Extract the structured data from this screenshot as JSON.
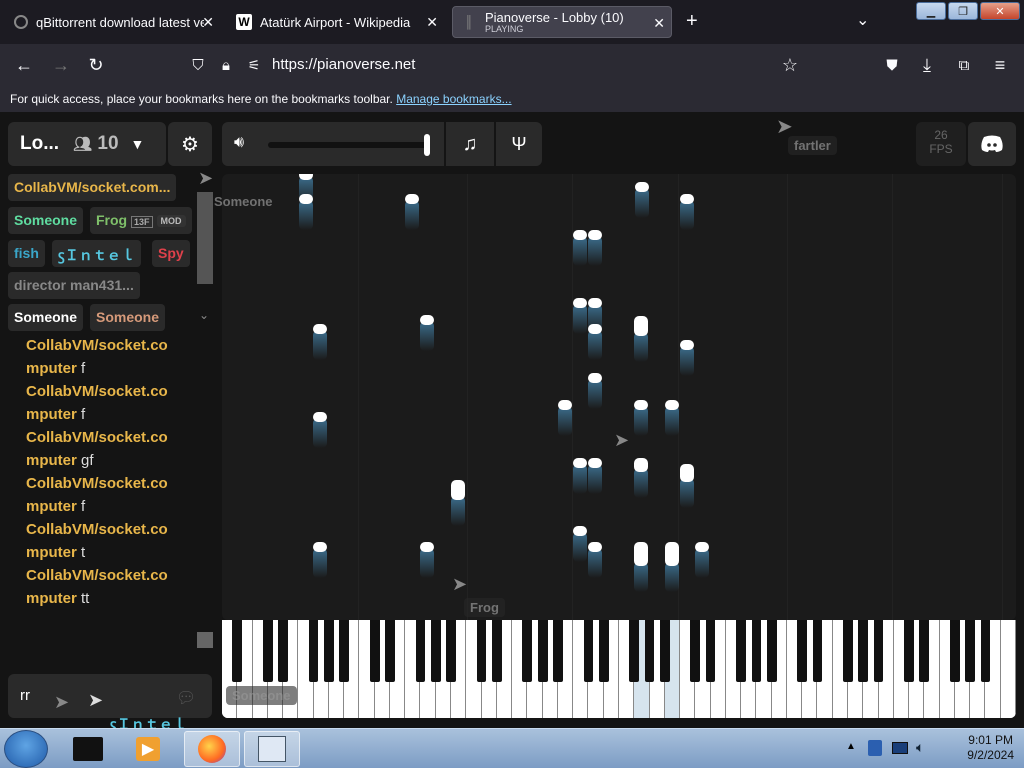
{
  "browser": {
    "tabs": [
      {
        "title": "qBittorrent download latest ver",
        "sub": ""
      },
      {
        "title": "Atatürk Airport - Wikipedia",
        "sub": ""
      },
      {
        "title": "Pianoverse - Lobby (10)",
        "sub": "PLAYING"
      }
    ],
    "url": "https://pianoverse.net",
    "bookmarks_text": "For quick access, place your bookmarks here on the bookmarks toolbar.",
    "bookmarks_link": "Manage bookmarks..."
  },
  "lobby": {
    "name": "Lo...",
    "count": "10",
    "fps_value": "26",
    "fps_label": "FPS"
  },
  "users": [
    {
      "name": "CollabVM/socket.com...",
      "color": "#e8b64a"
    },
    {
      "name": "Someone",
      "color": "#5fdca0"
    },
    {
      "name": "Frog",
      "color": "#7fc06a",
      "badge": "MOD"
    },
    {
      "name": "fish",
      "color": "#3aa6c9"
    },
    {
      "name": "ꚃＩｎｔｅｌ",
      "color": "#56c7e0"
    },
    {
      "name": "Spy",
      "color": "#e0414b"
    },
    {
      "name": "director man431...",
      "color": "#888888"
    },
    {
      "name": "Someone",
      "color": "#ffffff"
    },
    {
      "name": "Someone",
      "color": "#d69a7a"
    }
  ],
  "chat": [
    {
      "name": "CollabVM/socket.co",
      "cont": "mputer",
      "msg": "f"
    },
    {
      "name": "CollabVM/socket.co",
      "cont": "mputer",
      "msg": "f"
    },
    {
      "name": "CollabVM/socket.co",
      "cont": "mputer",
      "msg": "gf"
    },
    {
      "name": "CollabVM/socket.co",
      "cont": "mputer",
      "msg": "f"
    },
    {
      "name": "CollabVM/socket.co",
      "cont": "mputer",
      "msg": "t"
    },
    {
      "name": "CollabVM/socket.co",
      "cont": "mputer",
      "msg": "tt"
    }
  ],
  "chat_input_value": "rr",
  "cursors": {
    "fartler": "fartler",
    "someone_top": "Someone",
    "frog": "Frog",
    "someone_bottom": "Someone",
    "intel": "ꚃＩｎｔｅｌ"
  },
  "taskbar": {
    "time": "9:01 PM",
    "date": "9/2/2024"
  }
}
